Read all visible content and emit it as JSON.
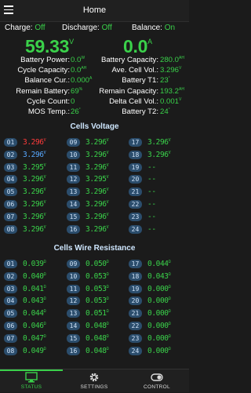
{
  "header": {
    "title": "Home"
  },
  "toggles": [
    {
      "label": "Charge:",
      "value": "Off"
    },
    {
      "label": "Discharge:",
      "value": "Off"
    },
    {
      "label": "Balance:",
      "value": "On"
    }
  ],
  "big": {
    "voltage": "59.33",
    "voltage_unit": "V",
    "current": "0.0",
    "current_unit": "A"
  },
  "stats_left": [
    {
      "label": "Battery Power:",
      "value": "0.0",
      "unit": "W"
    },
    {
      "label": "Cycle Capacity:",
      "value": "0.0",
      "unit": "AH"
    },
    {
      "label": "Balance Cur.:",
      "value": "0.000",
      "unit": "A"
    },
    {
      "label": "Remain Battery:",
      "value": "69",
      "unit": "%"
    },
    {
      "label": "Cycle Count:",
      "value": "0",
      "unit": ""
    },
    {
      "label": "MOS Temp.:",
      "value": "26",
      "unit": "°"
    }
  ],
  "stats_right": [
    {
      "label": "Battery Capacity:",
      "value": "280.0",
      "unit": "AH"
    },
    {
      "label": "Ave. Cell Vol.:",
      "value": "3.296",
      "unit": "V"
    },
    {
      "label": "Battery T1:",
      "value": "23",
      "unit": "°"
    },
    {
      "label": "Remain Capacity:",
      "value": "193.2",
      "unit": "AH"
    },
    {
      "label": "Delta Cell Vol.:",
      "value": "0.001",
      "unit": "V"
    },
    {
      "label": "Battery T2:",
      "value": "24",
      "unit": "°"
    }
  ],
  "cells_voltage": {
    "title": "Cells Voltage",
    "unit": "V",
    "cells": [
      {
        "id": "01",
        "value": "3.296",
        "tone": "red"
      },
      {
        "id": "02",
        "value": "3.296",
        "tone": "blue"
      },
      {
        "id": "03",
        "value": "3.295",
        "tone": ""
      },
      {
        "id": "04",
        "value": "3.296",
        "tone": ""
      },
      {
        "id": "05",
        "value": "3.296",
        "tone": ""
      },
      {
        "id": "06",
        "value": "3.296",
        "tone": ""
      },
      {
        "id": "07",
        "value": "3.296",
        "tone": ""
      },
      {
        "id": "08",
        "value": "3.296",
        "tone": ""
      },
      {
        "id": "09",
        "value": "3.296",
        "tone": ""
      },
      {
        "id": "10",
        "value": "3.296",
        "tone": ""
      },
      {
        "id": "11",
        "value": "3.296",
        "tone": ""
      },
      {
        "id": "12",
        "value": "3.295",
        "tone": ""
      },
      {
        "id": "13",
        "value": "3.296",
        "tone": ""
      },
      {
        "id": "14",
        "value": "3.296",
        "tone": ""
      },
      {
        "id": "15",
        "value": "3.296",
        "tone": ""
      },
      {
        "id": "16",
        "value": "3.296",
        "tone": ""
      },
      {
        "id": "17",
        "value": "3.296",
        "tone": ""
      },
      {
        "id": "18",
        "value": "3.296",
        "tone": ""
      },
      {
        "id": "19",
        "value": "--",
        "tone": ""
      },
      {
        "id": "20",
        "value": "--",
        "tone": ""
      },
      {
        "id": "21",
        "value": "--",
        "tone": ""
      },
      {
        "id": "22",
        "value": "--",
        "tone": ""
      },
      {
        "id": "23",
        "value": "--",
        "tone": ""
      },
      {
        "id": "24",
        "value": "--",
        "tone": ""
      }
    ]
  },
  "cells_resistance": {
    "title": "Cells Wire Resistance",
    "unit": "Ω",
    "cells": [
      {
        "id": "01",
        "value": "0.039"
      },
      {
        "id": "02",
        "value": "0.040"
      },
      {
        "id": "03",
        "value": "0.041"
      },
      {
        "id": "04",
        "value": "0.043"
      },
      {
        "id": "05",
        "value": "0.044"
      },
      {
        "id": "06",
        "value": "0.046"
      },
      {
        "id": "07",
        "value": "0.047"
      },
      {
        "id": "08",
        "value": "0.049"
      },
      {
        "id": "09",
        "value": "0.050"
      },
      {
        "id": "10",
        "value": "0.053"
      },
      {
        "id": "11",
        "value": "0.053"
      },
      {
        "id": "12",
        "value": "0.053"
      },
      {
        "id": "13",
        "value": "0.051"
      },
      {
        "id": "14",
        "value": "0.048"
      },
      {
        "id": "15",
        "value": "0.048"
      },
      {
        "id": "16",
        "value": "0.048"
      },
      {
        "id": "17",
        "value": "0.044"
      },
      {
        "id": "18",
        "value": "0.043"
      },
      {
        "id": "19",
        "value": "0.000"
      },
      {
        "id": "20",
        "value": "0.000"
      },
      {
        "id": "21",
        "value": "0.000"
      },
      {
        "id": "22",
        "value": "0.000"
      },
      {
        "id": "23",
        "value": "0.000"
      },
      {
        "id": "24",
        "value": "0.000"
      }
    ]
  },
  "tabs": [
    {
      "label": "STATUS",
      "icon": "monitor-icon",
      "active": true
    },
    {
      "label": "SETTINGS",
      "icon": "gear-icon",
      "active": false
    },
    {
      "label": "CONTROL",
      "icon": "toggle-icon",
      "active": false
    }
  ],
  "colors": {
    "accent": "#3ad14a",
    "badge": "#2b4d6c",
    "max_cell": "#ff3b3b",
    "min_cell": "#57a8ff"
  }
}
